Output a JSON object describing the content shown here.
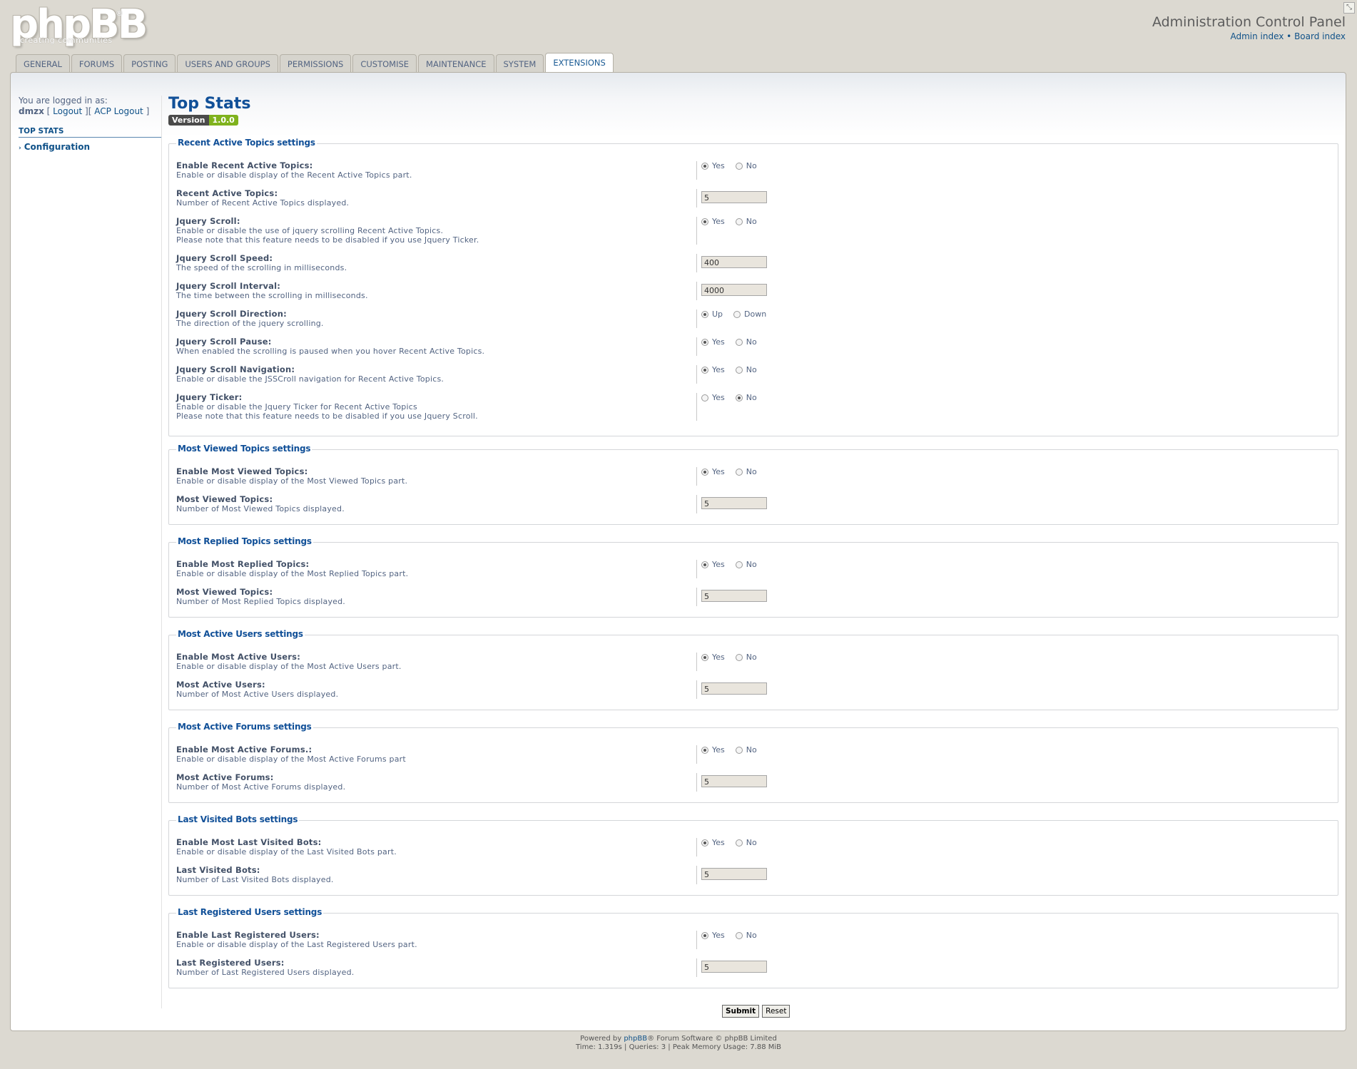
{
  "header": {
    "logo_text": "phpBB",
    "logo_reg": "®",
    "logo_tagline": "creating communities",
    "acp_title": "Administration Control Panel",
    "admin_index": "Admin index",
    "separator": "•",
    "board_index": "Board index"
  },
  "tabs": [
    {
      "label": "GENERAL",
      "active": false
    },
    {
      "label": "FORUMS",
      "active": false
    },
    {
      "label": "POSTING",
      "active": false
    },
    {
      "label": "USERS AND GROUPS",
      "active": false
    },
    {
      "label": "PERMISSIONS",
      "active": false
    },
    {
      "label": "CUSTOMISE",
      "active": false
    },
    {
      "label": "MAINTENANCE",
      "active": false
    },
    {
      "label": "SYSTEM",
      "active": false
    },
    {
      "label": "EXTENSIONS",
      "active": true
    }
  ],
  "menu": {
    "logged_in_as": "You are logged in as:",
    "username": "dmzx",
    "logout": "Logout",
    "acp_logout": "ACP Logout",
    "section": "TOP STATS",
    "item": "Configuration"
  },
  "main": {
    "title": "Top Stats",
    "version_label": "Version",
    "version_value": "1.0.0"
  },
  "sections": [
    {
      "legend": "Recent Active Topics settings",
      "rows": [
        {
          "label": "Enable Recent Active Topics:",
          "desc": [
            "Enable or disable display of the Recent Active Topics part."
          ],
          "type": "radio",
          "options": [
            "Yes",
            "No"
          ],
          "selected": 0
        },
        {
          "label": "Recent Active Topics:",
          "desc": [
            "Number of Recent Active Topics displayed."
          ],
          "type": "text",
          "value": "5"
        },
        {
          "label": "Jquery Scroll:",
          "desc": [
            "Enable or disable the use of jquery scrolling Recent Active Topics.",
            "Please note that this feature needs to be disabled if you use Jquery Ticker."
          ],
          "type": "radio",
          "options": [
            "Yes",
            "No"
          ],
          "selected": 0
        },
        {
          "label": "Jquery Scroll Speed:",
          "desc": [
            "The speed of the scrolling in milliseconds."
          ],
          "type": "text",
          "value": "400"
        },
        {
          "label": "Jquery Scroll Interval:",
          "desc": [
            "The time between the scrolling in milliseconds."
          ],
          "type": "text",
          "value": "4000"
        },
        {
          "label": "Jquery Scroll Direction:",
          "desc": [
            "The direction of the jquery scrolling."
          ],
          "type": "radio",
          "options": [
            "Up",
            "Down"
          ],
          "selected": 0
        },
        {
          "label": "Jquery Scroll Pause:",
          "desc": [
            "When enabled the scrolling is paused when you hover Recent Active Topics."
          ],
          "type": "radio",
          "options": [
            "Yes",
            "No"
          ],
          "selected": 0
        },
        {
          "label": "Jquery Scroll Navigation:",
          "desc": [
            "Enable or disable the JSSCroll navigation for Recent Active Topics."
          ],
          "type": "radio",
          "options": [
            "Yes",
            "No"
          ],
          "selected": 0
        },
        {
          "label": "Jquery Ticker:",
          "desc": [
            "Enable or disable the Jquery Ticker for Recent Active Topics",
            "Please note that this feature needs to be disabled if you use Jquery Scroll."
          ],
          "type": "radio",
          "options": [
            "Yes",
            "No"
          ],
          "selected": 1
        }
      ]
    },
    {
      "legend": "Most Viewed Topics settings",
      "rows": [
        {
          "label": "Enable Most Viewed Topics:",
          "desc": [
            "Enable or disable display of the Most Viewed Topics part."
          ],
          "type": "radio",
          "options": [
            "Yes",
            "No"
          ],
          "selected": 0
        },
        {
          "label": "Most Viewed Topics:",
          "desc": [
            "Number of Most Viewed Topics displayed."
          ],
          "type": "text",
          "value": "5"
        }
      ]
    },
    {
      "legend": "Most Replied Topics settings",
      "rows": [
        {
          "label": "Enable Most Replied Topics:",
          "desc": [
            "Enable or disable display of the Most Replied Topics part."
          ],
          "type": "radio",
          "options": [
            "Yes",
            "No"
          ],
          "selected": 0
        },
        {
          "label": "Most Viewed Topics:",
          "desc": [
            "Number of Most Replied Topics displayed."
          ],
          "type": "text",
          "value": "5"
        }
      ]
    },
    {
      "legend": "Most Active Users settings",
      "rows": [
        {
          "label": "Enable Most Active Users:",
          "desc": [
            "Enable or disable display of the Most Active Users part."
          ],
          "type": "radio",
          "options": [
            "Yes",
            "No"
          ],
          "selected": 0
        },
        {
          "label": "Most Active Users:",
          "desc": [
            "Number of Most Active Users displayed."
          ],
          "type": "text",
          "value": "5"
        }
      ]
    },
    {
      "legend": "Most Active Forums settings",
      "rows": [
        {
          "label": "Enable Most Active Forums.:",
          "desc": [
            "Enable or disable display of the Most Active Forums part"
          ],
          "type": "radio",
          "options": [
            "Yes",
            "No"
          ],
          "selected": 0
        },
        {
          "label": "Most Active Forums:",
          "desc": [
            "Number of Most Active Forums displayed."
          ],
          "type": "text",
          "value": "5"
        }
      ]
    },
    {
      "legend": "Last Visited Bots settings",
      "rows": [
        {
          "label": "Enable Most Last Visited Bots:",
          "desc": [
            "Enable or disable display of the Last Visited Bots part."
          ],
          "type": "radio",
          "options": [
            "Yes",
            "No"
          ],
          "selected": 0
        },
        {
          "label": "Last Visited Bots:",
          "desc": [
            "Number of Last Visited Bots displayed."
          ],
          "type": "text",
          "value": "5"
        }
      ]
    },
    {
      "legend": "Last Registered Users settings",
      "rows": [
        {
          "label": "Enable Last Registered Users:",
          "desc": [
            "Enable or disable display of the Last Registered Users part."
          ],
          "type": "radio",
          "options": [
            "Yes",
            "No"
          ],
          "selected": 0
        },
        {
          "label": "Last Registered Users:",
          "desc": [
            "Number of Last Registered Users displayed."
          ],
          "type": "text",
          "value": "5"
        }
      ]
    }
  ],
  "buttons": {
    "submit": "Submit",
    "reset": "Reset"
  },
  "footer": {
    "line1_pre": "Powered by ",
    "line1_link": "phpBB",
    "line1_post": "® Forum Software © phpBB Limited",
    "line2": "Time: 1.319s | Queries: 3 | Peak Memory Usage: 7.88 MiB"
  }
}
